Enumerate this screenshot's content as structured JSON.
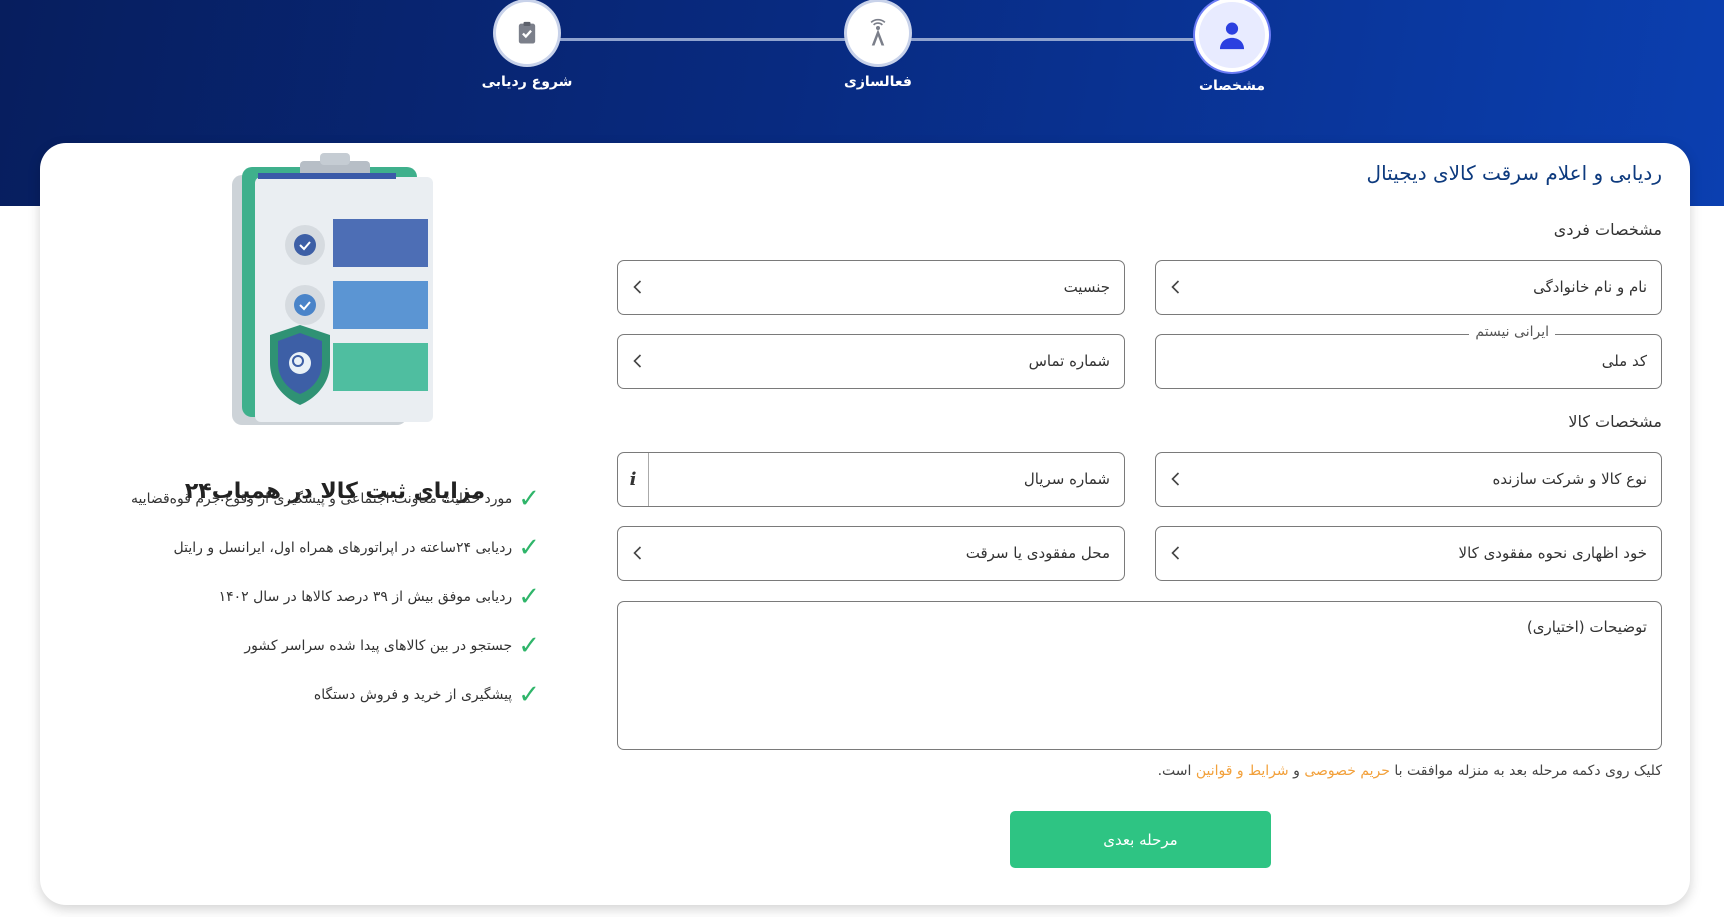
{
  "stepper": {
    "steps": [
      {
        "label": "شروع ردیابی",
        "icon": "clipboard-check-icon",
        "active": false
      },
      {
        "label": "فعالسازی",
        "icon": "antenna-icon",
        "active": false
      },
      {
        "label": "مشخصات",
        "icon": "user-icon",
        "active": true
      }
    ]
  },
  "form": {
    "title": "ردیابی و اعلام سرقت کالای دیجیتال",
    "personal_section": "مشخصات فردی",
    "full_name": "نام و نام خانوادگی",
    "gender": "جنسیت",
    "national_code": "کد ملی",
    "non_iranian": "ایرانی نیستم",
    "phone": "شماره تماس",
    "product_section": "مشخصات کالا",
    "product_type": "نوع کالا و شرکت سازنده",
    "serial": "شماره سریال",
    "info_icon": "i",
    "loss_declaration": "خود اظهاری نحوه مفقودی کالا",
    "loss_location": "محل مفقودی یا سرقت",
    "description": "توضیحات (اختیاری)",
    "consent_prefix": "کلیک روی دکمه مرحله بعد به منزله موافقت با",
    "privacy_link": "حریم خصوصی",
    "and": "و",
    "terms_link": "شرایط و قوانین",
    "consent_suffix": "است.",
    "next_button": "مرحله بعدی"
  },
  "benefits": {
    "title": "مزایای ثبت کالا در همیاب۲۴",
    "items": [
      "مورد حمایت معاونت اجتماعی و پیشگیری از وقوع جرم قوه‌قضاییه",
      "ردیابی ۲۴ساعته در اپراتورهای همراه اول، ایرانسل و رایتل",
      "ردیابی موفق بیش از ۳۹ درصد کالاها در سال ۱۴۰۲",
      "جستجو در بین کالاهای پیدا شده سراسر کشور",
      "پیشگیری از خرید و فروش دستگاه"
    ]
  },
  "colors": {
    "header": "#082a80",
    "accent_green": "#2ec483",
    "link_orange": "#f2a03a",
    "title_blue": "#0d3a7e"
  }
}
